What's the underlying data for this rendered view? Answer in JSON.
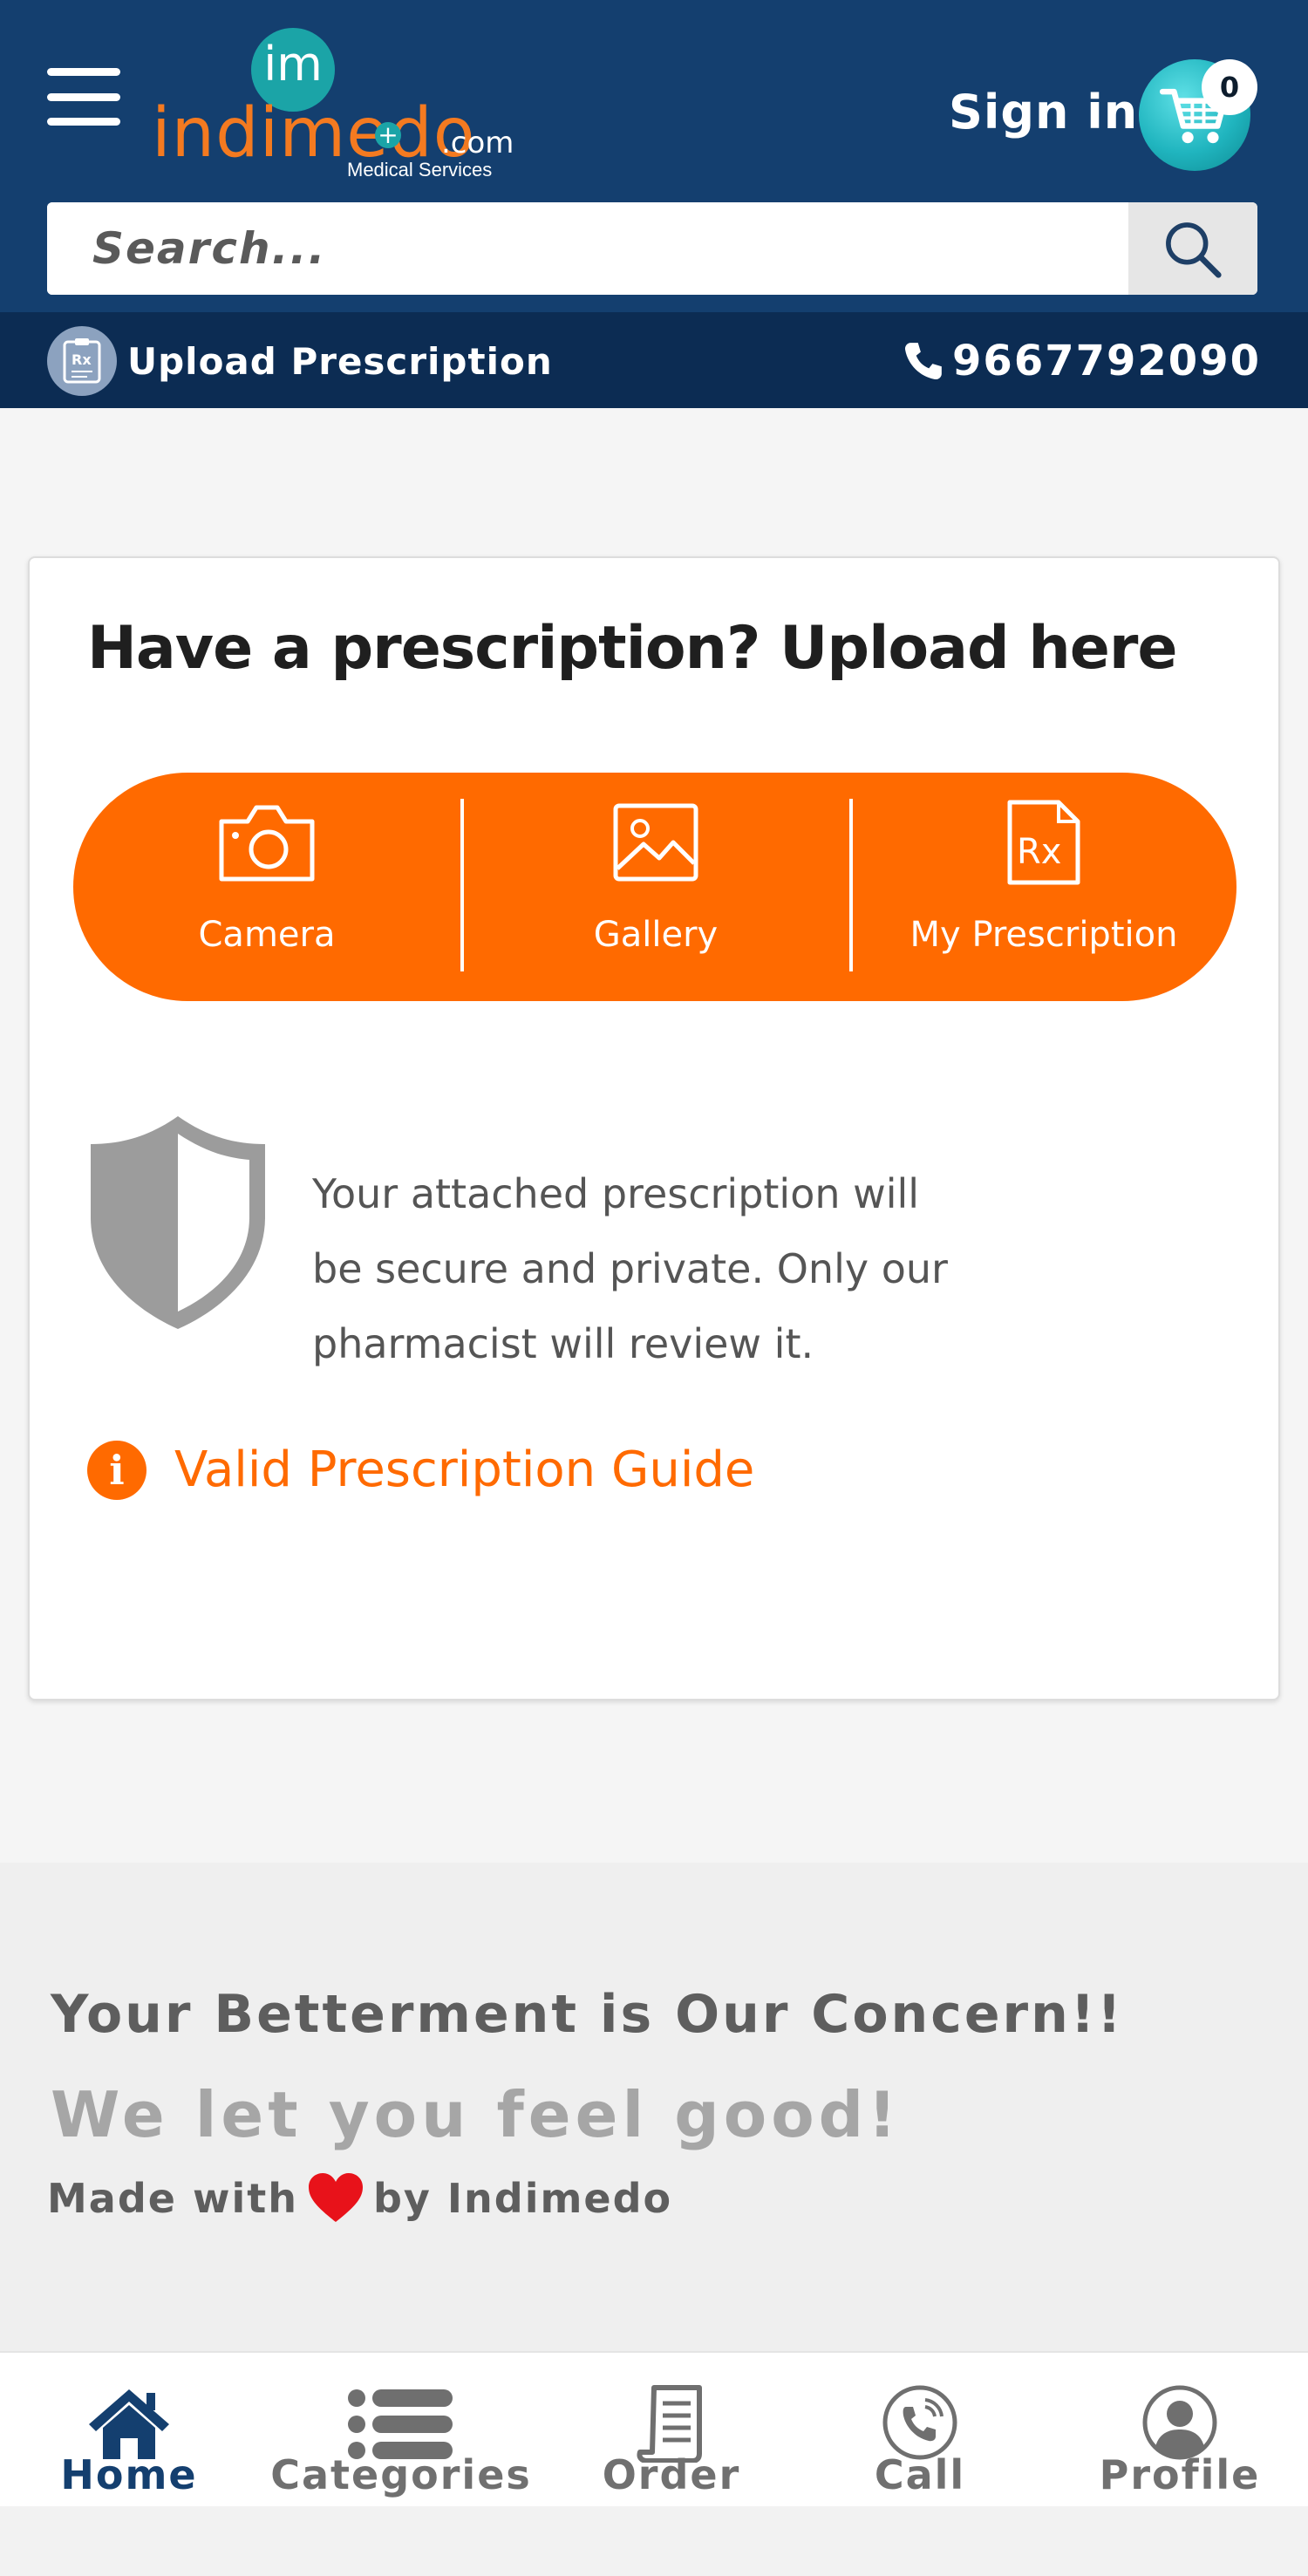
{
  "header": {
    "logo": {
      "brand": "indimedo",
      "badge": "im",
      "domain": ".com",
      "tagline": "Medical Services"
    },
    "signin_label": "Sign in",
    "cart_count": "0",
    "colors": {
      "primary": "#143f6f",
      "accent": "#ff6a00",
      "brand_orange": "#f47a20",
      "teal": "#1ba4a7"
    }
  },
  "search": {
    "placeholder": "Search...",
    "value": "",
    "icon": "search-icon"
  },
  "subbar": {
    "upload_label": "Upload Prescription",
    "upload_icon": "prescription-icon",
    "phone": "9667792090",
    "phone_icon": "phone-icon"
  },
  "upload_card": {
    "title": "Have a prescription? Upload here",
    "options": [
      {
        "label": "Camera",
        "icon": "camera-icon"
      },
      {
        "label": "Gallery",
        "icon": "gallery-icon"
      },
      {
        "label": "My Prescription",
        "icon": "rx-document-icon"
      }
    ],
    "secure_text": [
      "Your attached prescription will",
      "be secure and private. Only our",
      "pharmacist will review it."
    ],
    "guide_label": "Valid Prescription Guide",
    "guide_icon": "info-icon"
  },
  "footer": {
    "tagline1": "Your Betterment is Our Concern!!",
    "tagline2": "We let you feel good!",
    "made_with_prefix": "Made with",
    "made_with_suffix": "by Indimedo"
  },
  "bottom_nav": {
    "items": [
      {
        "label": "Home",
        "icon": "home-icon",
        "active": true
      },
      {
        "label": "Categories",
        "icon": "list-icon",
        "active": false
      },
      {
        "label": "Order",
        "icon": "receipt-icon",
        "active": false
      },
      {
        "label": "Call",
        "icon": "phone-call-icon",
        "active": false
      },
      {
        "label": "Profile",
        "icon": "user-icon",
        "active": false
      }
    ]
  }
}
